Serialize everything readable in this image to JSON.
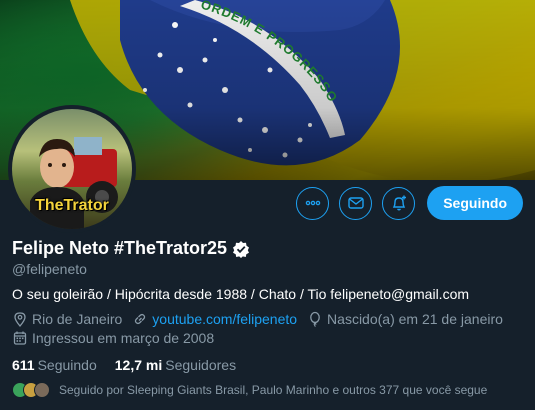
{
  "banner": {
    "flag_motto": "ORDEM E PROGRESSO",
    "colors": {
      "green": "#1a7a2e",
      "yellow": "#d7c400",
      "blue": "#1f3b8a"
    }
  },
  "avatar": {
    "caption": "TheTrator"
  },
  "actions": {
    "more_icon": "more-horizontal-icon",
    "message_icon": "envelope-icon",
    "notify_icon": "bell-plus-icon",
    "follow_label": "Seguindo"
  },
  "profile": {
    "name": "Felipe Neto #TheTrator25",
    "handle": "@felipeneto",
    "bio": "O seu goleirão / Hipócrita desde 1988 / Chato / Tio felipeneto@gmail.com",
    "location": "Rio de Janeiro",
    "website": "youtube.com/felipeneto",
    "birthday": "Nascido(a) em 21 de janeiro",
    "joined": "Ingressou em março de 2008"
  },
  "stats": {
    "following_count": "611",
    "following_label": "Seguindo",
    "followers_count": "12,7 mi",
    "followers_label": "Seguidores"
  },
  "followed_by": {
    "text": "Seguido por Sleeping Giants Brasil, Paulo Marinho e outros 377 que você segue"
  },
  "theme": {
    "accent": "#1da1f2",
    "background": "#15202b",
    "muted": "#8899a6"
  }
}
